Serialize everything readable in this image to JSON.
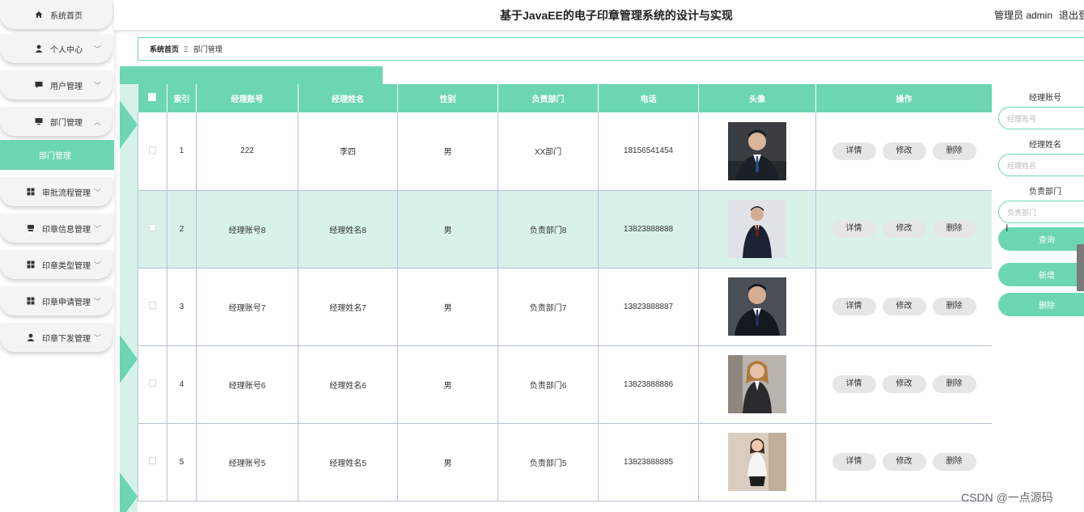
{
  "app": {
    "title": "基于JavaEE的电子印章管理系统的设计与实现",
    "user": "管理员 admin",
    "logout": "退出登录"
  },
  "sidebar": {
    "items": [
      {
        "label": "系统首页",
        "icon": "home-icon",
        "chev": ""
      },
      {
        "label": "个人中心",
        "icon": "user-icon",
        "chev": "﹀"
      },
      {
        "label": "用户管理",
        "icon": "chat-icon",
        "chev": "﹀"
      },
      {
        "label": "部门管理",
        "icon": "monitor-icon",
        "chev": "︿"
      },
      {
        "label": "审批流程管理",
        "icon": "grid-icon",
        "chev": "﹀"
      },
      {
        "label": "印章信息管理",
        "icon": "stamp-icon",
        "chev": "﹀"
      },
      {
        "label": "印章类型管理",
        "icon": "grid-icon",
        "chev": "﹀"
      },
      {
        "label": "印章申请管理",
        "icon": "grid-icon",
        "chev": "﹀"
      },
      {
        "label": "印章下发管理",
        "icon": "user-icon",
        "chev": "﹀"
      }
    ],
    "submenu": "部门管理"
  },
  "breadcrumb": {
    "home": "系统首页",
    "sep": "Ξ",
    "current": "部门管理"
  },
  "table": {
    "headers": [
      "索引",
      "经理账号",
      "经理姓名",
      "性别",
      "负责部门",
      "电话",
      "头像",
      "操作"
    ],
    "rows": [
      {
        "index": "1",
        "account": "222",
        "name": "李四",
        "gender": "男",
        "dept": "XX部门",
        "phone": "18156541454"
      },
      {
        "index": "2",
        "account": "经理账号8",
        "name": "经理姓名8",
        "gender": "男",
        "dept": "负责部门8",
        "phone": "13823888888"
      },
      {
        "index": "3",
        "account": "经理账号7",
        "name": "经理姓名7",
        "gender": "男",
        "dept": "负责部门7",
        "phone": "13823888887"
      },
      {
        "index": "4",
        "account": "经理账号6",
        "name": "经理姓名6",
        "gender": "男",
        "dept": "负责部门6",
        "phone": "13823888886"
      },
      {
        "index": "5",
        "account": "经理账号5",
        "name": "经理姓名5",
        "gender": "男",
        "dept": "负责部门5",
        "phone": "13823888885"
      }
    ],
    "actions": {
      "detail": "详情",
      "edit": "修改",
      "delete": "删除"
    }
  },
  "search": {
    "account_label": "经理账号",
    "account_placeholder": "经理账号",
    "name_label": "经理姓名",
    "name_placeholder": "经理姓名",
    "dept_label": "负责部门",
    "dept_placeholder": "负责部门",
    "query_btn": "查询",
    "add_btn": "新增",
    "delete_btn": "删除"
  },
  "watermark": "CSDN @一点源码",
  "colors": {
    "accent": "#6cd6b3",
    "accent_light": "#d8f2ea"
  }
}
